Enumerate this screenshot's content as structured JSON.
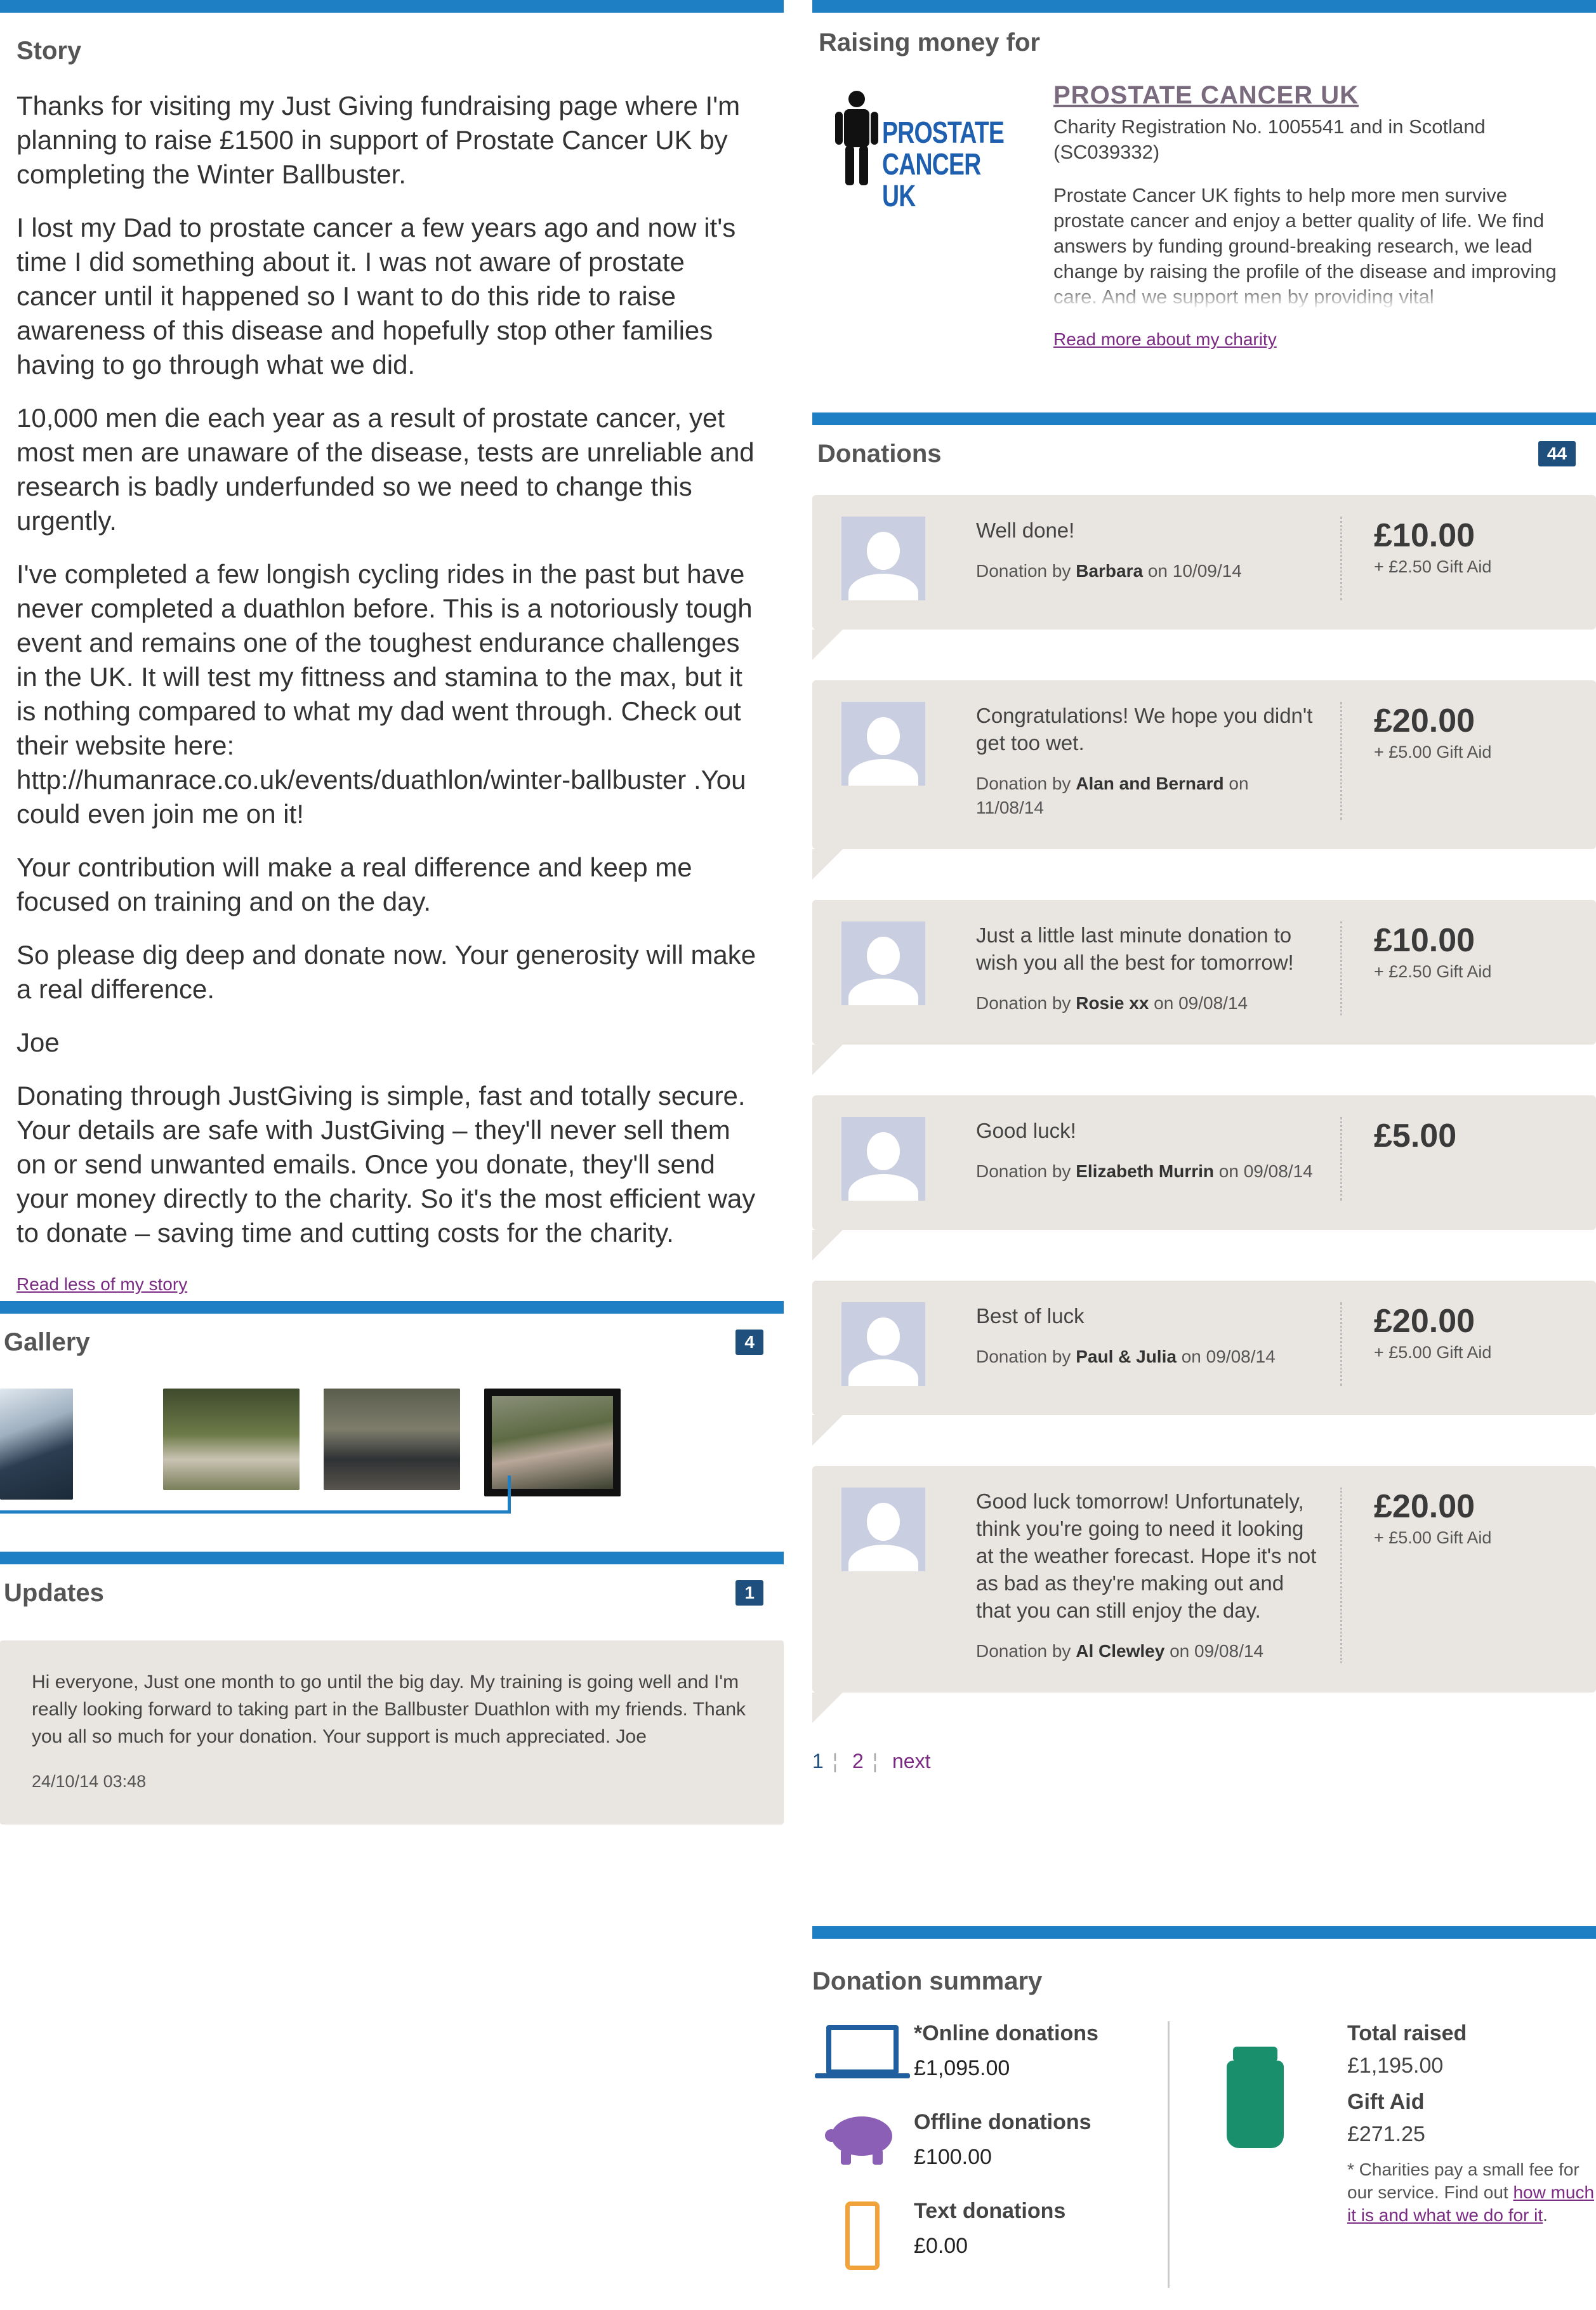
{
  "story": {
    "title": "Story",
    "paragraphs": [
      "Thanks for visiting my Just Giving fundraising page where I'm planning to raise £1500 in support of Prostate Cancer UK by completing the Winter Ballbuster.",
      "I lost my Dad to prostate cancer a few years ago and now it's time I did something about it. I was not aware of prostate cancer until it happened so I want to do this ride to raise awareness of this disease and hopefully stop other families having to go through what we did.",
      "10,000 men die each year as a result of prostate cancer, yet most men are unaware of the disease, tests are unreliable and research is badly underfunded so we need to change this urgently.",
      "I've completed a few longish cycling rides in the past but have never completed a duathlon before. This is a notoriously tough event and remains one of the toughest endurance challenges in the UK. It will test my fittness and stamina to the max, but it is nothing compared to what my dad went through. Check out their website here: http://humanrace.co.uk/events/duathlon/winter-ballbuster .You could even join me on it!",
      "Your contribution will make a real difference and keep me focused on training and on the day.",
      "So please dig deep and donate now. Your generosity will make a real difference.",
      "Joe",
      "Donating through JustGiving is simple, fast and totally secure. Your details are safe with JustGiving – they'll never sell them on or send unwanted emails. Once you donate, they'll send your money directly to the charity. So it's the most efficient way to donate – saving time and cutting costs for the charity."
    ],
    "read_less": "Read less of my story"
  },
  "gallery": {
    "title": "Gallery",
    "count": "4"
  },
  "updates": {
    "title": "Updates",
    "count": "1",
    "text": "Hi everyone, Just one month to go until the big day. My training is going well and I'm really looking forward to taking part in the Ballbuster Duathlon with my friends. Thank you all so much for your donation. Your support is much appreciated. Joe",
    "date": "24/10/14 03:48"
  },
  "charity": {
    "section_title": "Raising money for",
    "logo_line1": "PROSTATE",
    "logo_line2": "CANCER UK",
    "name": "PROSTATE CANCER UK",
    "registration": "Charity Registration No. 1005541 and in Scotland (SC039332)",
    "description": "Prostate Cancer UK fights to help more men survive prostate cancer and enjoy a better quality of life. We find answers by funding ground-breaking research, we lead change by raising the profile of the disease and improving care. And we support men by providing vital",
    "read_more": "Read more about my charity"
  },
  "donations": {
    "title": "Donations",
    "count": "44",
    "by_prefix": "Donation by",
    "on_word": "on",
    "items": [
      {
        "message": "Well done!",
        "donor": "Barbara",
        "date": "10/09/14",
        "amount": "£10.00",
        "gift_aid": "+ £2.50 Gift Aid"
      },
      {
        "message": "Congratulations! We hope you didn't get too wet.",
        "donor": "Alan and Bernard",
        "date": "11/08/14",
        "amount": "£20.00",
        "gift_aid": "+ £5.00 Gift Aid"
      },
      {
        "message": "Just a little last minute donation to wish you all the best for tomorrow!",
        "donor": "Rosie xx",
        "date": "09/08/14",
        "amount": "£10.00",
        "gift_aid": "+ £2.50 Gift Aid"
      },
      {
        "message": "Good luck!",
        "donor": "Elizabeth Murrin",
        "date": "09/08/14",
        "amount": "£5.00",
        "gift_aid": ""
      },
      {
        "message": "Best of luck",
        "donor": "Paul & Julia",
        "date": "09/08/14",
        "amount": "£20.00",
        "gift_aid": "+ £5.00 Gift Aid"
      },
      {
        "message": "Good luck tomorrow! Unfortunately, think you're going to need it looking at the weather forecast. Hope it's not as bad as they're making out and that you can still enjoy the day.",
        "donor": "Al Clewley",
        "date": "09/08/14",
        "amount": "£20.00",
        "gift_aid": "+ £5.00 Gift Aid"
      }
    ]
  },
  "pager": {
    "page1": "1",
    "page2": "2",
    "next": "next"
  },
  "summary": {
    "title": "Donation summary",
    "online_label": "*Online donations",
    "online_value": "£1,095.00",
    "offline_label": "Offline donations",
    "offline_value": "£100.00",
    "text_label": "Text donations",
    "text_value": "£0.00",
    "total_label": "Total raised",
    "total_value": "£1,195.00",
    "giftaid_label": "Gift Aid",
    "giftaid_value": "£271.25",
    "footnote_pre": "* Charities pay a small fee for our service. Find out ",
    "footnote_link": "how much it is and what we do for it",
    "footnote_post": "."
  },
  "colors": {
    "accent": "#1f7fc4",
    "badge": "#1f4f7d",
    "link": "#7a2a83",
    "card": "#e9e6e1"
  }
}
